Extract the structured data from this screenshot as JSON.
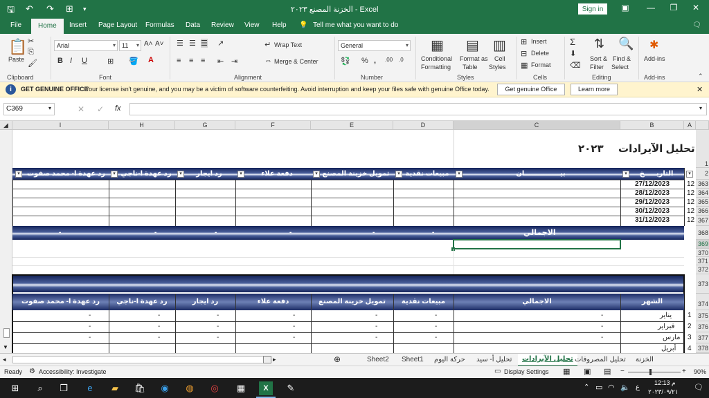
{
  "titlebar": {
    "title": "الخزنة المصنع ٢٠٢٣ - Excel",
    "sign_in": "Sign in",
    "qa_save": "🖫",
    "qa_undo": "↶",
    "qa_redo": "↷",
    "qa_custom": "▾"
  },
  "tabs": [
    "File",
    "Home",
    "Insert",
    "Page Layout",
    "Formulas",
    "Data",
    "Review",
    "View",
    "Help"
  ],
  "tell_me": "Tell me what you want to do",
  "ribbon": {
    "paste": "Paste",
    "clipboard": "Clipboard",
    "font_name": "Arial",
    "font_size": "11",
    "font": "Font",
    "wrap_text": "Wrap Text",
    "merge_center": "Merge & Center",
    "alignment": "Alignment",
    "number_format": "General",
    "number": "Number",
    "conditional": "Conditional",
    "formatting": "Formatting",
    "format_as": "Format as",
    "table": "Table",
    "cell": "Cell",
    "styles_btn": "Styles",
    "styles": "Styles",
    "insert": "Insert",
    "delete": "Delete",
    "format": "Format",
    "cells": "Cells",
    "sort": "Sort &",
    "filter": "Filter",
    "find": "Find &",
    "select": "Select",
    "editing": "Editing",
    "addins": "Add-ins",
    "addins_group": "Add-ins"
  },
  "message": {
    "header": "GET GENUINE OFFICE",
    "text": "Your license isn't genuine, and you may be a victim of software counterfeiting. Avoid interruption and keep your files safe with genuine Office today.",
    "btn_genuine": "Get genuine Office",
    "btn_learn": "Learn more"
  },
  "formula": {
    "name_box": "C369",
    "fx": "fx",
    "value": ""
  },
  "columns": [
    "I",
    "H",
    "G",
    "F",
    "E",
    "D",
    "C",
    "B",
    "A"
  ],
  "rows_top": [
    "1",
    "2",
    "363",
    "364",
    "365",
    "366",
    "367",
    "368",
    "369",
    "370",
    "371",
    "372",
    "373",
    "374",
    "375",
    "376",
    "377",
    "378"
  ],
  "sheet": {
    "title": "تحليل الآيرادات",
    "year": "٢٠٢٣",
    "headers_top": [
      "رد عهدة ا- محمد صفوت",
      "رد عهدة ا-ناجي",
      "رد ايجار",
      "دفعة علاء",
      "تمويل خزينة المصنع",
      "مبيعات نقدية",
      "بيـــــــــــــــان",
      "التاريـــــخ"
    ],
    "dates": [
      "27/12/2023",
      "28/12/2023",
      "29/12/2023",
      "30/12/2023",
      "31/12/2023"
    ],
    "col_a": [
      "12",
      "12",
      "12",
      "12",
      "12"
    ],
    "total_label": "الاجمالي",
    "dash": "-",
    "headers_bottom": [
      "رد عهدة ا- محمد صفوت",
      "رد عهدة ا-ناجي",
      "رد ايجار",
      "دفعة علاء",
      "تمويل خزينة المصنع",
      "مبيعات نقدية",
      "الاجمالي",
      "الشهر"
    ],
    "months": [
      "يناير",
      "فبراير",
      "مارس",
      "أبريل"
    ],
    "month_nums": [
      "1",
      "2",
      "3",
      "4"
    ]
  },
  "sheet_tabs": [
    "الخزنة",
    "تحليل المصروفات",
    "تحليل الآيرادات",
    "تحليل أ- سيد",
    "حركة اليوم",
    "Sheet1",
    "Sheet2"
  ],
  "status": {
    "ready": "Ready",
    "accessibility": "Accessibility: Investigate",
    "display_settings": "Display Settings",
    "zoom": "90%"
  },
  "taskbar": {
    "time": "12:13 م",
    "date": "٢٠٢٣/٠٩/٢١",
    "lang": "ع"
  }
}
